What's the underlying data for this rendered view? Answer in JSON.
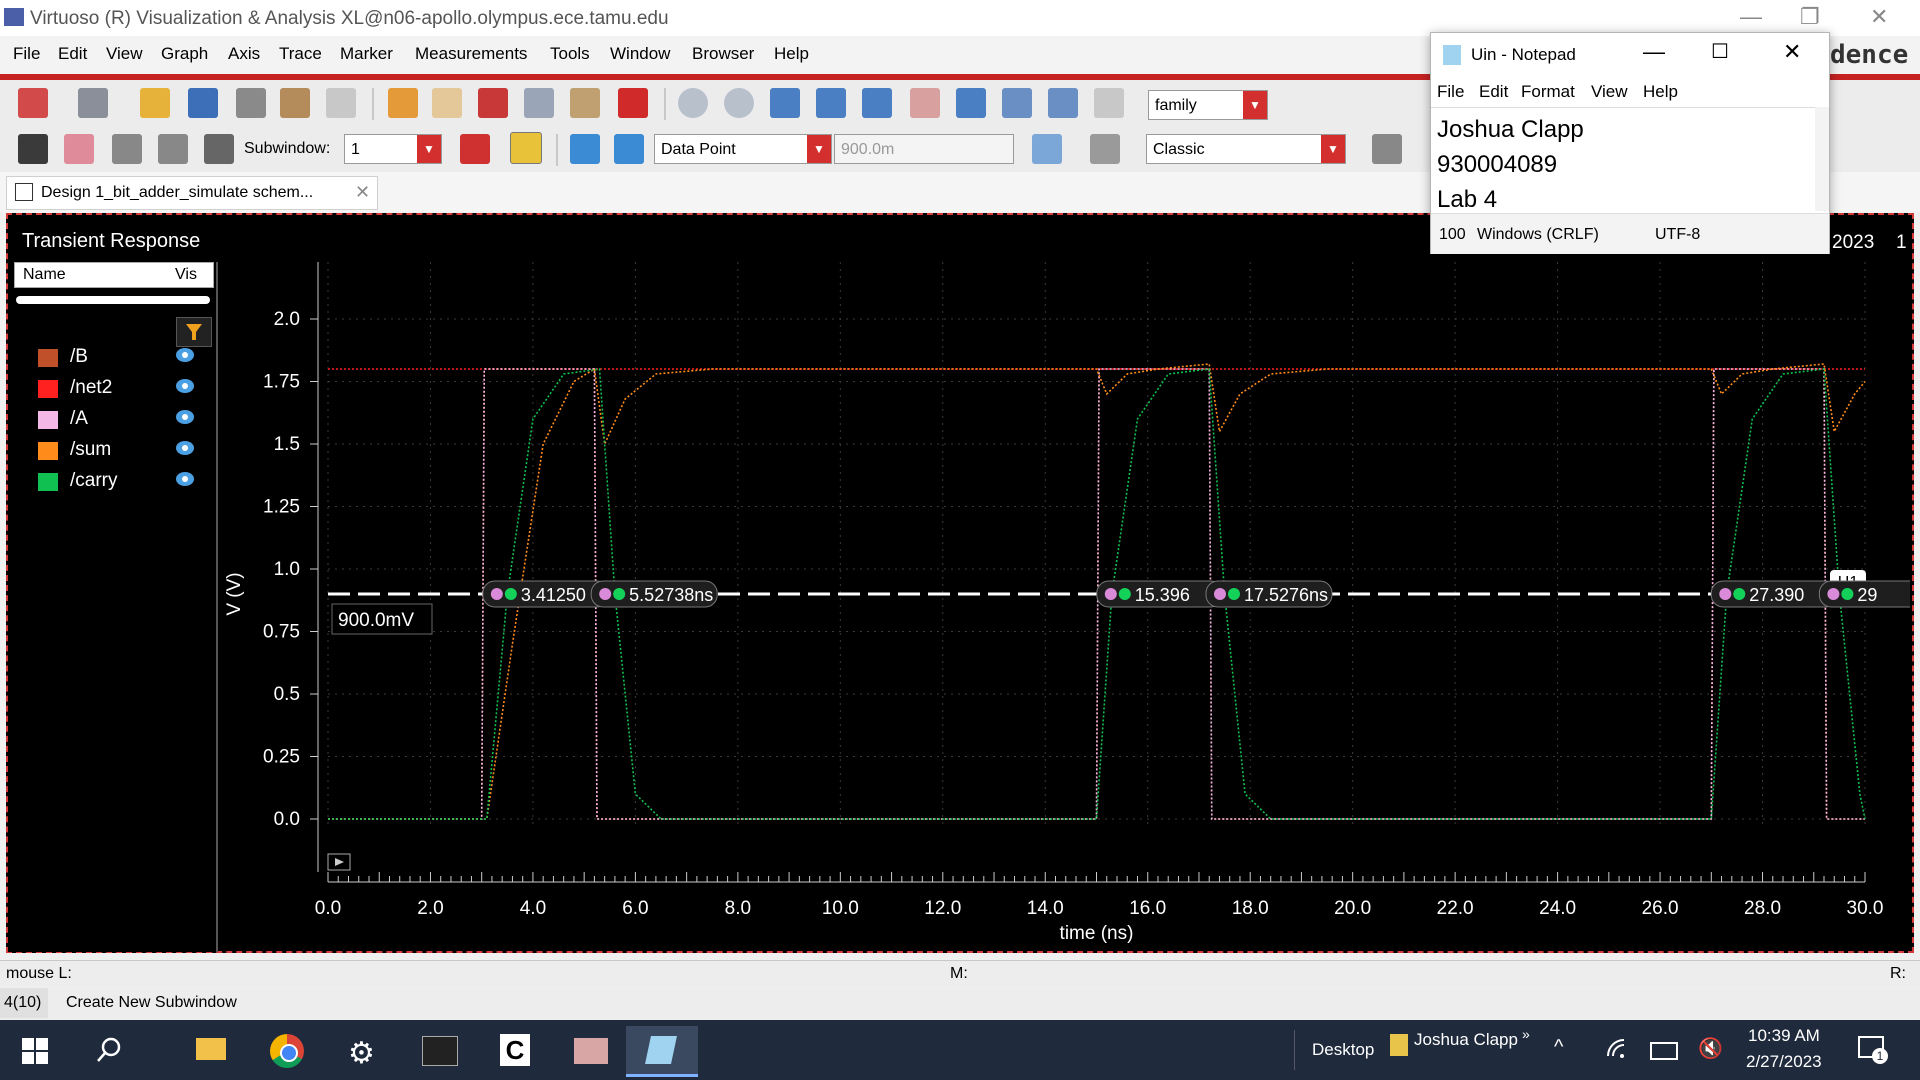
{
  "window": {
    "title": "Virtuoso (R) Visualization & Analysis XL@n06-apollo.olympus.ece.tamu.edu",
    "brand_fragment": "dence"
  },
  "menu": [
    "File",
    "Edit",
    "View",
    "Graph",
    "Axis",
    "Trace",
    "Marker",
    "Measurements",
    "Tools",
    "Window",
    "Browser",
    "Help"
  ],
  "toolbar": {
    "family_combo": "family",
    "subwindow_label": "Subwindow:",
    "subwindow_value": "1",
    "marker_mode": "Data Point",
    "marker_value": "900.0m",
    "style_combo": "Classic"
  },
  "tab": {
    "label": "Design 1_bit_adder_simulate schem..."
  },
  "plot": {
    "panel_title": "Transient Response",
    "legend_header_name": "Name",
    "legend_header_vis": "Vis",
    "date_fragment": "2023",
    "date_fragment2": "1",
    "hmarker_label": "H1",
    "hmarker_value": "900.0mV"
  },
  "chart_data": {
    "type": "line",
    "title": "Transient Response",
    "xlabel": "time (ns)",
    "ylabel": "V (V)",
    "xlim": [
      0,
      30
    ],
    "ylim": [
      -0.2,
      2.0
    ],
    "x_ticks": [
      "0.0",
      "2.0",
      "4.0",
      "6.0",
      "8.0",
      "10.0",
      "12.0",
      "14.0",
      "16.0",
      "18.0",
      "20.0",
      "22.0",
      "24.0",
      "26.0",
      "28.0",
      "30.0"
    ],
    "y_ticks": [
      "2.0",
      "1.75",
      "1.5",
      "1.25",
      "1.0",
      "0.75",
      "0.5",
      "0.25",
      "0.0"
    ],
    "grid": true,
    "series": [
      {
        "name": "/B",
        "color": "#c0502a",
        "x": [
          0,
          3.0,
          3.05,
          5.2,
          5.25,
          15.0,
          15.05,
          17.2,
          17.25,
          27.0,
          27.05,
          29.2,
          29.25,
          30
        ],
        "y": [
          0,
          0,
          1.8,
          1.8,
          0,
          0,
          1.8,
          1.8,
          0,
          0,
          1.8,
          1.8,
          0,
          0
        ]
      },
      {
        "name": "/net2",
        "color": "#ff2020",
        "x": [
          0,
          3.0,
          3.05,
          30
        ],
        "y": [
          1.8,
          1.8,
          1.8,
          1.8
        ]
      },
      {
        "name": "/A",
        "color": "#f4b8e6",
        "x": [
          0,
          3.0,
          3.05,
          5.2,
          5.25,
          15.0,
          15.05,
          17.2,
          17.25,
          27.0,
          27.05,
          29.2,
          29.25,
          30
        ],
        "y": [
          0,
          0,
          1.8,
          1.8,
          0,
          0,
          1.8,
          1.8,
          0,
          0,
          1.8,
          1.8,
          0,
          0
        ]
      },
      {
        "name": "/sum",
        "color": "#ff8c1a",
        "x": [
          0,
          3.1,
          3.6,
          4.2,
          4.8,
          5.2,
          5.4,
          5.8,
          6.4,
          7.5,
          15.0,
          15.2,
          15.6,
          16.2,
          17.2,
          17.4,
          17.8,
          18.4,
          19.5,
          27.0,
          27.2,
          27.6,
          28.2,
          29.2,
          29.4,
          29.8,
          30
        ],
        "y": [
          0,
          0,
          0.7,
          1.5,
          1.75,
          1.8,
          1.5,
          1.68,
          1.78,
          1.8,
          1.8,
          1.7,
          1.78,
          1.8,
          1.82,
          1.55,
          1.7,
          1.78,
          1.8,
          1.8,
          1.7,
          1.78,
          1.8,
          1.82,
          1.55,
          1.7,
          1.75
        ]
      },
      {
        "name": "/carry",
        "color": "#10c050",
        "x": [
          0,
          3.1,
          3.5,
          4.0,
          4.6,
          5.3,
          5.6,
          6.0,
          6.5,
          15.0,
          15.3,
          15.8,
          16.4,
          17.2,
          17.5,
          17.9,
          18.4,
          27.0,
          27.3,
          27.8,
          28.4,
          29.2,
          29.5,
          29.9,
          30
        ],
        "y": [
          0,
          0,
          0.9,
          1.6,
          1.78,
          1.8,
          0.9,
          0.1,
          0,
          0,
          0.9,
          1.6,
          1.78,
          1.8,
          0.9,
          0.1,
          0,
          0,
          0.9,
          1.6,
          1.78,
          1.8,
          0.9,
          0.1,
          0
        ]
      }
    ],
    "markers": [
      {
        "label": "3.41250",
        "x": 3.4125
      },
      {
        "label": "5.52738ns",
        "x": 5.52738
      },
      {
        "label": "15.396",
        "x": 15.396
      },
      {
        "label": "17.5276ns",
        "x": 17.5276
      },
      {
        "label": "27.390",
        "x": 27.39
      },
      {
        "label": "29",
        "x": 29.5
      }
    ],
    "hmarker_y": 0.9
  },
  "status": {
    "mouse": "mouse L:",
    "mid": "M:",
    "right": "R:",
    "count": "4(10)",
    "hint": "Create New Subwindow"
  },
  "notepad": {
    "title": "Uin - Notepad",
    "menu": [
      "File",
      "Edit",
      "Format",
      "View",
      "Help"
    ],
    "lines": [
      "Joshua Clapp",
      "930004089",
      "Lab 4"
    ],
    "zoom": "100",
    "eol": "Windows (CRLF)",
    "encoding": "UTF-8"
  },
  "taskbar": {
    "desktop_label": "Desktop",
    "user": "Joshua Clapp",
    "time": "10:39 AM",
    "date": "2/27/2023",
    "notif_count": "1"
  }
}
